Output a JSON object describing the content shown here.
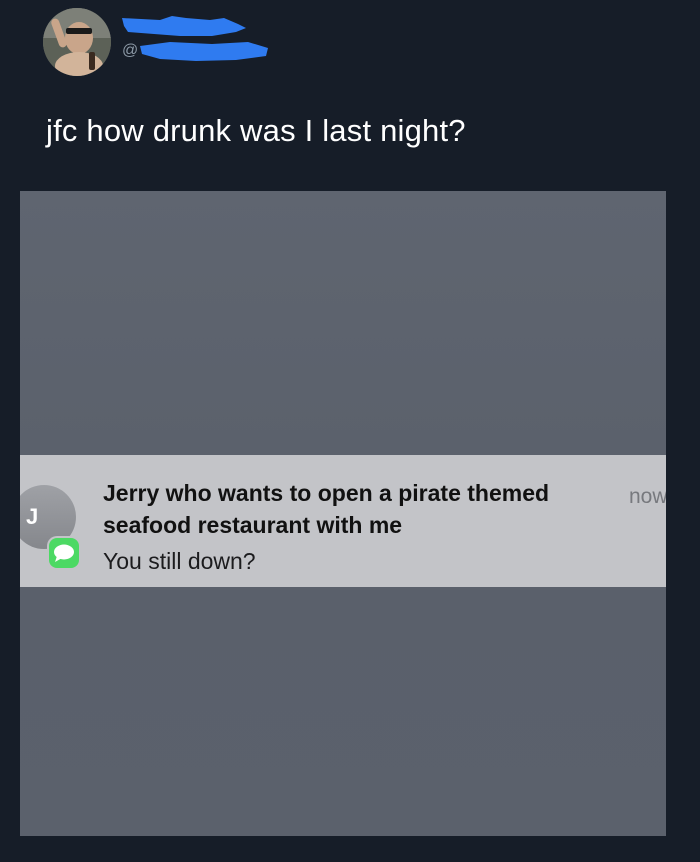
{
  "tweet": {
    "handle_prefix": "@",
    "text": "jfc how drunk was I last night?"
  },
  "notification": {
    "avatar_initial": "J",
    "app_icon": "messages-bubble-icon",
    "title": "Jerry who wants to open a pirate themed seafood restaurant with me",
    "message": "You still down?",
    "time": "now"
  },
  "colors": {
    "background": "#161d28",
    "redaction": "#2f7bf0",
    "messages_green": "#4cd964",
    "notification_bg": "#c3c4c8"
  }
}
